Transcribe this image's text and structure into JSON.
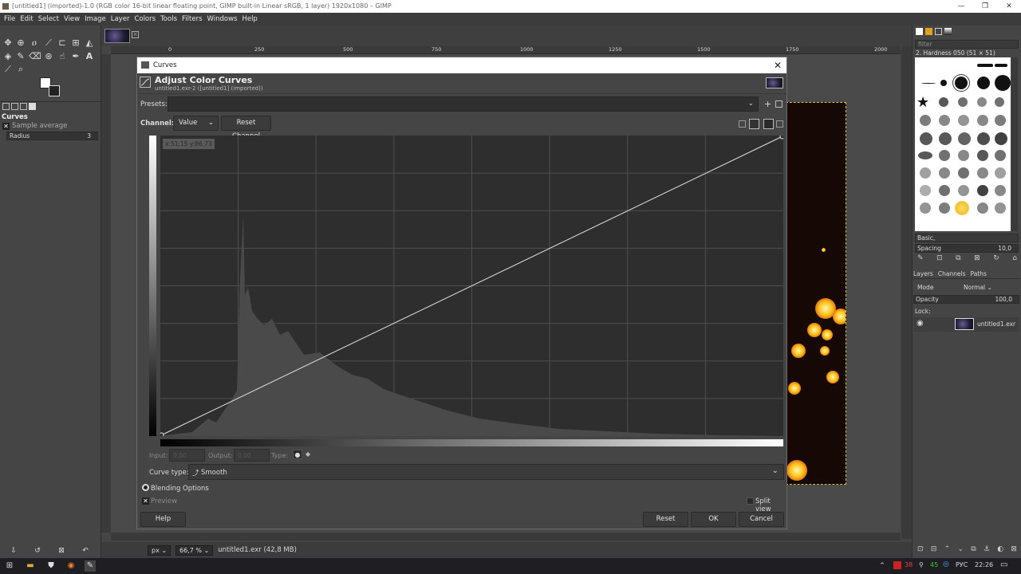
{
  "window": {
    "title": "[untitled1] (imported)-1.0 (RGB color 16-bit linear floating point, GIMP built-in Linear sRGB, 1 layer) 1920x1080 – GIMP",
    "controls": [
      "—",
      "❐",
      "✕"
    ]
  },
  "menu": [
    "File",
    "Edit",
    "Select",
    "View",
    "Image",
    "Layer",
    "Colors",
    "Tools",
    "Filters",
    "Windows",
    "Help"
  ],
  "tool_options": {
    "title": "Curves",
    "sample_average_label": "Sample average",
    "radius_label": "Radius",
    "radius_value": "3"
  },
  "ruler_top_labels": [
    "0",
    "250",
    "500",
    "750",
    "1000",
    "1250",
    "1500",
    "1750",
    "2000"
  ],
  "status": {
    "unit": "px",
    "zoom": "66,7 %",
    "file": "untitled1.exr (42,8 MB)"
  },
  "dialog": {
    "title": "Curves",
    "heading": "Adjust Color Curves",
    "subheading": "untitled1.exr-2 ([untitled1] (imported))",
    "presets_label": "Presets:",
    "channel_label": "Channel:",
    "channel_value": "Value",
    "reset_channel": "Reset Channel",
    "coordinate_readout": "x:51,15 y:86,73",
    "input_label": "Input:",
    "input_value": "0,00",
    "output_label": "Output:",
    "output_value": "0,00",
    "type_label": "Type:",
    "curve_type_label": "Curve type:",
    "curve_type_value": "Smooth",
    "blending_options": "Blending Options",
    "preview_label": "Preview",
    "split_view_label": "Split view",
    "buttons": {
      "help": "Help",
      "reset": "Reset",
      "ok": "OK",
      "cancel": "Cancel"
    }
  },
  "right_panel": {
    "filter_placeholder": "filter",
    "brush_name": "2. Hardness 050 (51 × 51)",
    "brush_set": "Basic,",
    "spacing_label": "Spacing",
    "spacing_value": "10,0",
    "tabs": [
      "Layers",
      "Channels",
      "Paths"
    ],
    "mode_label": "Mode",
    "mode_value": "Normal",
    "opacity_label": "Opacity",
    "opacity_value": "100,0",
    "lock_label": "Lock:",
    "layer_name": "untitled1.exr"
  },
  "taskbar": {
    "lang": "РУС",
    "time": "22:26",
    "tray_red": "38",
    "tray_green": "45"
  },
  "colors": {
    "accent_curve": "#e0e0e0",
    "selection": "#d2c03a"
  }
}
